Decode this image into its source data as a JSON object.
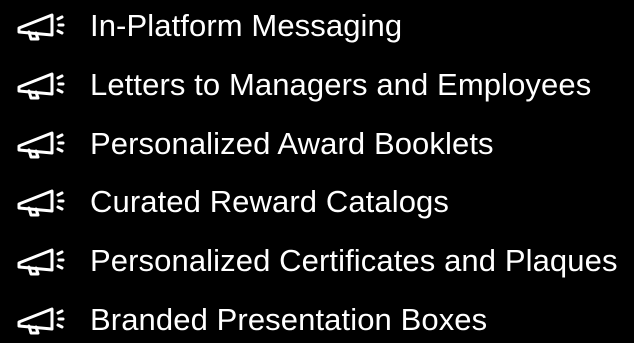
{
  "colors": {
    "background": "#000000",
    "text": "#ffffff",
    "icon": "#ffffff"
  },
  "list": {
    "icon": "megaphone-icon",
    "items": [
      {
        "label": "In-Platform Messaging"
      },
      {
        "label": "Letters to Managers and Employees"
      },
      {
        "label": "Personalized Award Booklets"
      },
      {
        "label": "Curated Reward Catalogs"
      },
      {
        "label": "Personalized Certificates and Plaques"
      },
      {
        "label": "Branded Presentation Boxes"
      }
    ]
  }
}
